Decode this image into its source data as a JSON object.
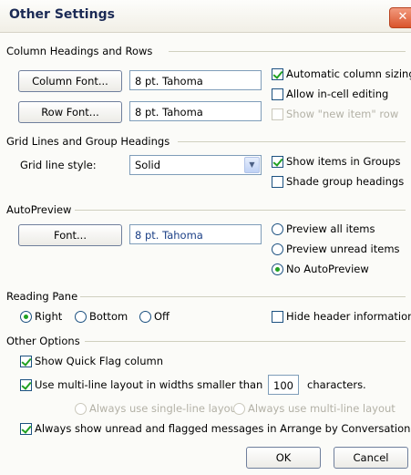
{
  "dialog": {
    "title": "Other Settings",
    "close_glyph": "✕"
  },
  "column_headings": {
    "section_label": "Column Headings and Rows",
    "column_font_button": "Column Font...",
    "column_font_value": "8 pt. Tahoma",
    "row_font_button": "Row Font...",
    "row_font_value": "8 pt. Tahoma",
    "auto_sizing": {
      "label": "Automatic column sizing",
      "checked": true
    },
    "in_cell_editing": {
      "label": "Allow in-cell editing",
      "checked": false
    },
    "show_new_item_row": {
      "label": "Show \"new item\" row",
      "checked": false,
      "disabled": true
    }
  },
  "grid_lines": {
    "section_label": "Grid Lines and Group Headings",
    "style_label": "Grid line style:",
    "style_value": "Solid",
    "show_in_groups": {
      "label": "Show items in Groups",
      "checked": true
    },
    "shade_group_headings": {
      "label": "Shade group headings",
      "checked": false
    }
  },
  "autopreview": {
    "section_label": "AutoPreview",
    "font_button": "Font...",
    "font_value": "8 pt. Tahoma",
    "preview_all": {
      "label": "Preview all items",
      "checked": false
    },
    "preview_unread": {
      "label": "Preview unread items",
      "checked": false
    },
    "no_autopreview": {
      "label": "No AutoPreview",
      "checked": true
    }
  },
  "reading_pane": {
    "section_label": "Reading Pane",
    "right": {
      "label": "Right",
      "checked": true
    },
    "bottom": {
      "label": "Bottom",
      "checked": false
    },
    "off": {
      "label": "Off",
      "checked": false
    },
    "hide_header": {
      "label": "Hide header information",
      "checked": false
    }
  },
  "other_options": {
    "section_label": "Other Options",
    "quick_flag": {
      "label": "Show Quick Flag column",
      "checked": true
    },
    "multiline": {
      "label_before": "Use multi-line layout in widths smaller than",
      "value": "100",
      "label_after": "characters.",
      "checked": true
    },
    "always_single": {
      "label": "Always use single-line layout",
      "disabled": true
    },
    "always_multi": {
      "label": "Always use multi-line layout",
      "disabled": true
    },
    "always_show_unread": {
      "label": "Always show unread and flagged messages in Arrange by Conversation",
      "checked": true
    }
  },
  "footer": {
    "ok": "OK",
    "cancel": "Cancel"
  },
  "colors": {
    "accent_check": "#21a121",
    "title_text": "#1b2a55",
    "close_button": "#d9542c"
  }
}
